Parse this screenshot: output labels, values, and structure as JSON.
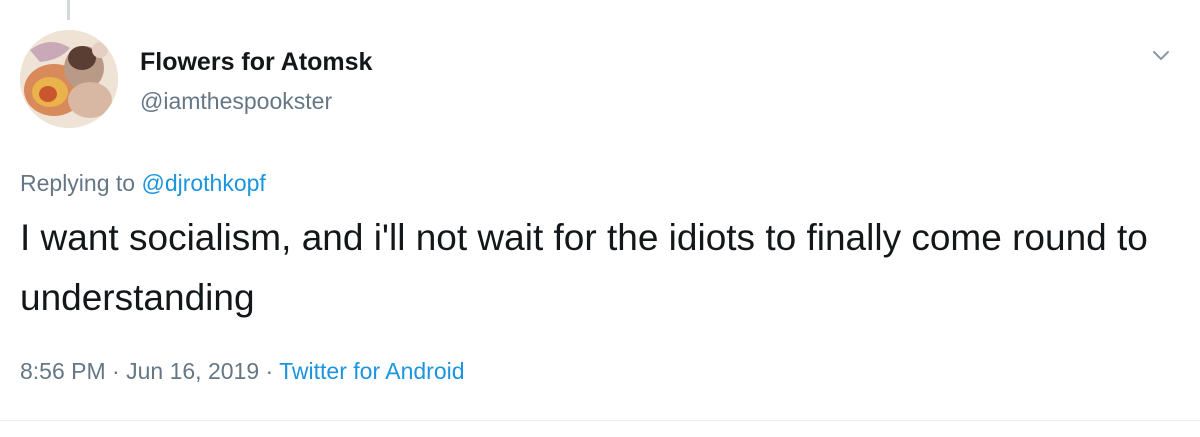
{
  "tweet": {
    "author": {
      "display_name": "Flowers for Atomsk",
      "handle": "@iamthespookster",
      "avatar_icon": "profile-avatar"
    },
    "reply": {
      "prefix": "Replying to ",
      "mention": "@djrothkopf"
    },
    "text": "I want socialism, and i'll not wait for the idiots to finally come round to understanding",
    "time": "8:56 PM",
    "separator": " · ",
    "date": "Jun 16, 2019",
    "separator2": " · ",
    "source": "Twitter for Android",
    "menu_icon": "chevron-down-icon"
  },
  "colors": {
    "primary_text": "#14171a",
    "secondary_text": "#657786",
    "link": "#1b95e0"
  }
}
